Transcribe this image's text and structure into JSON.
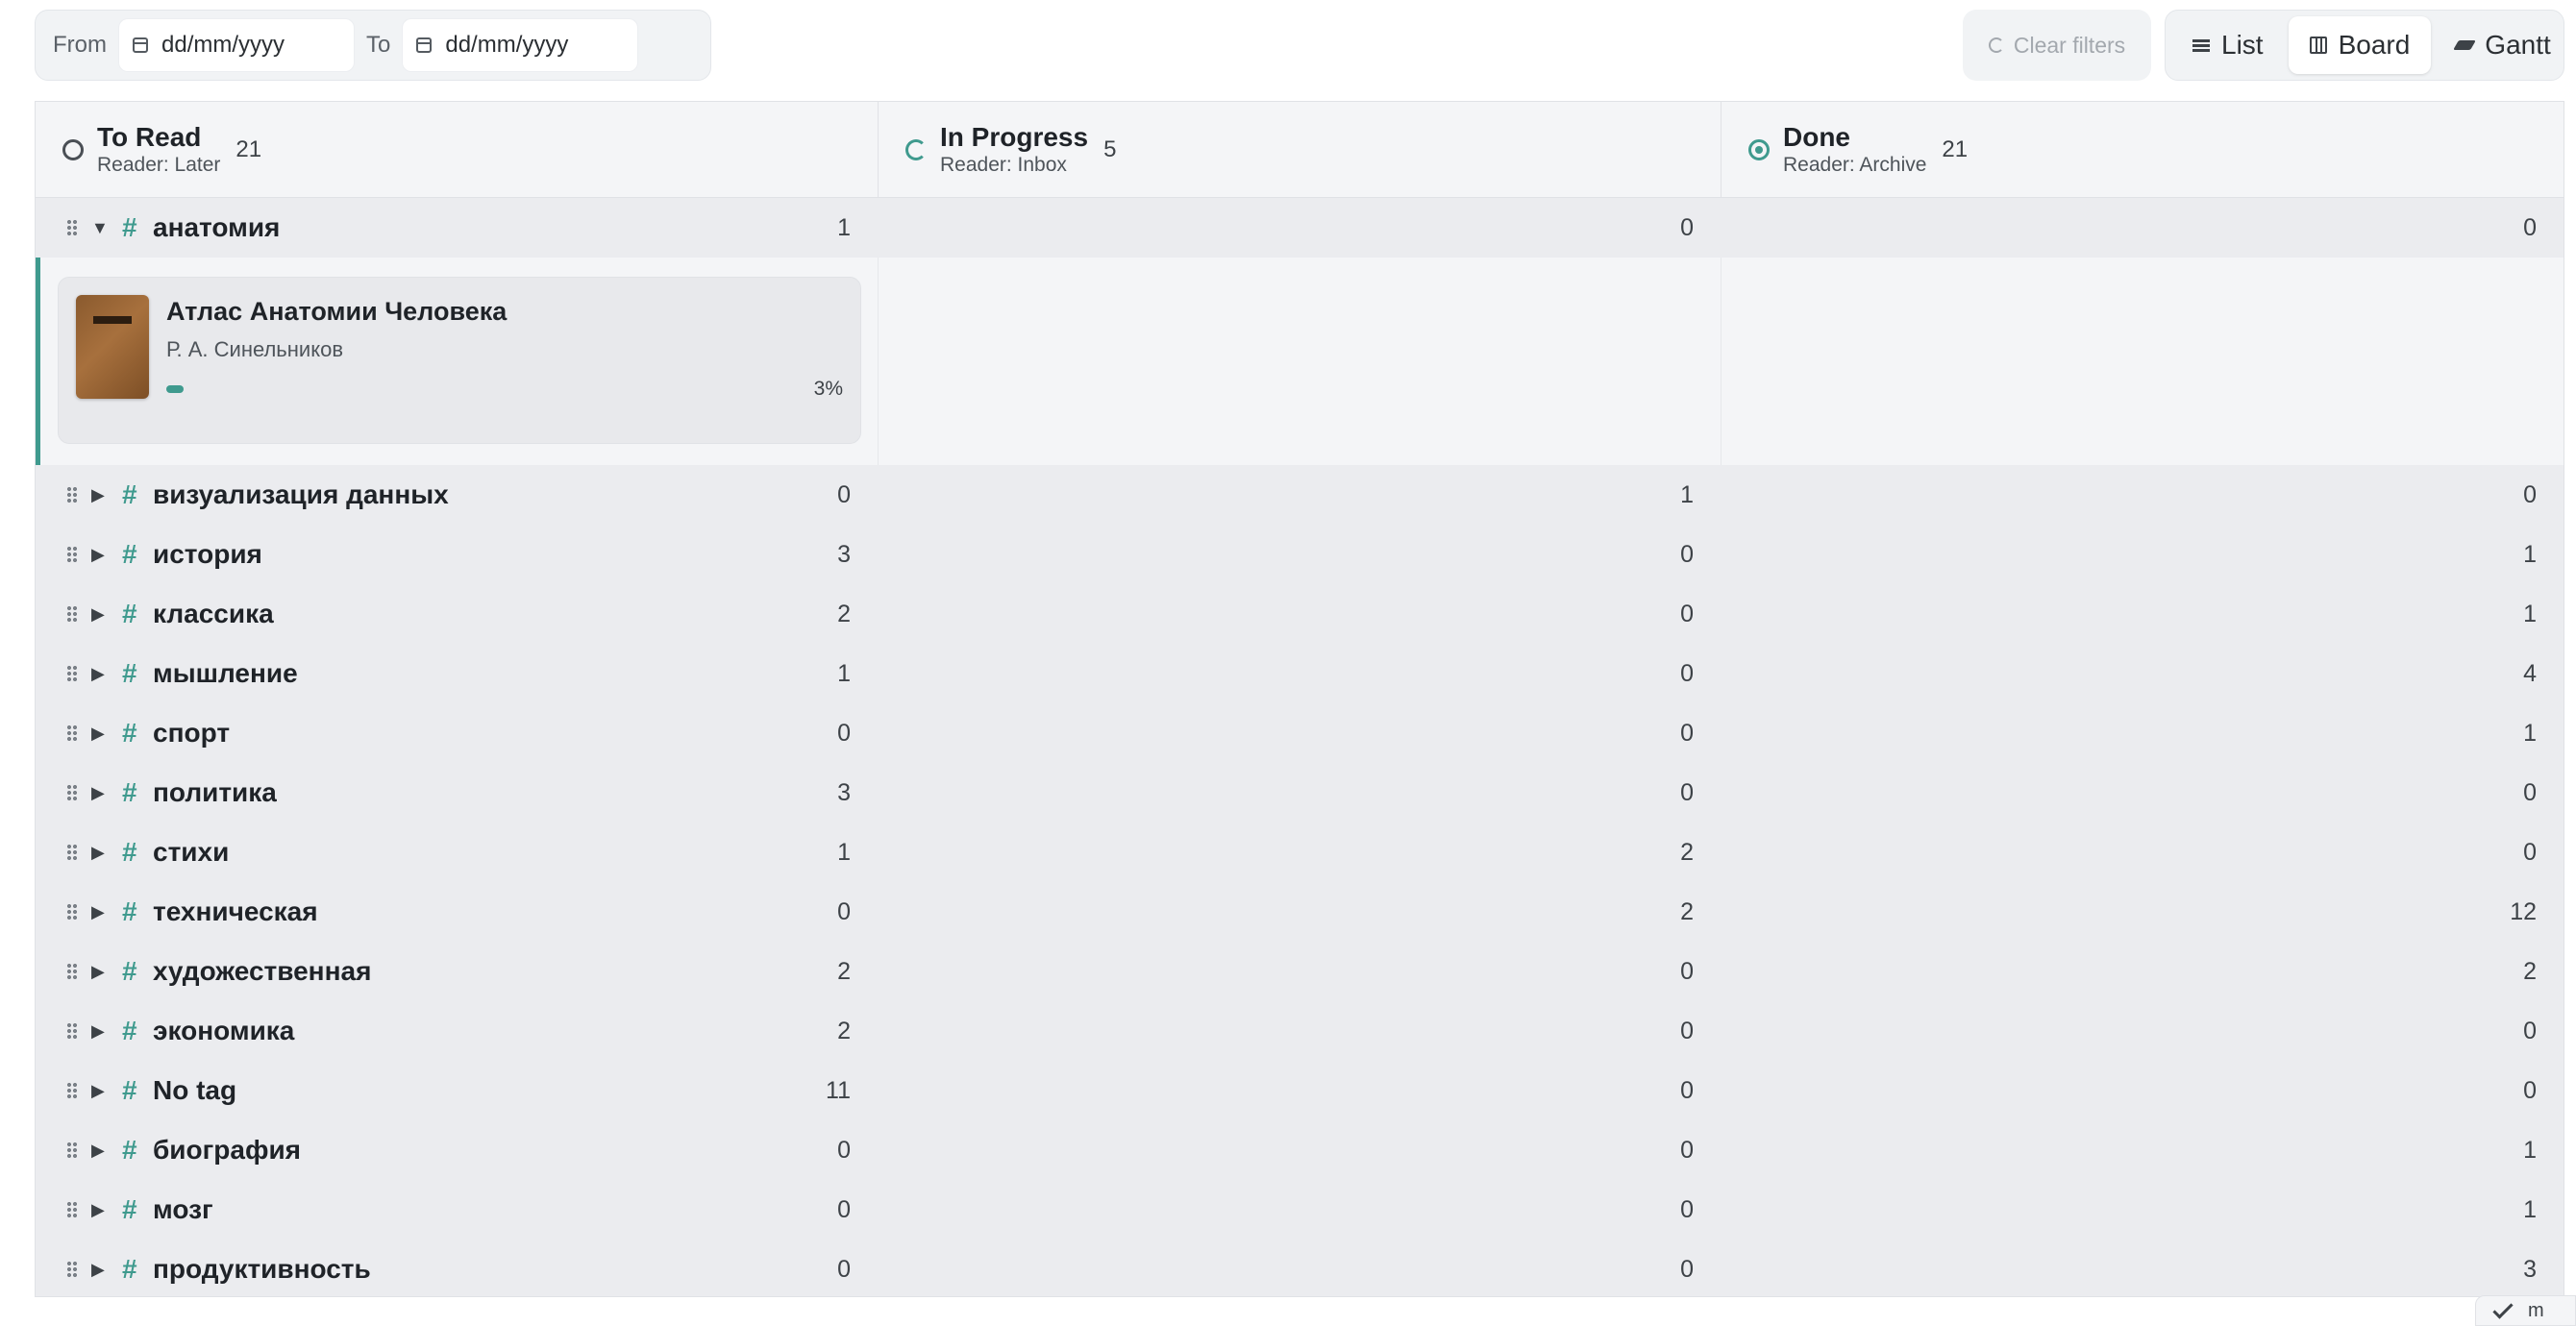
{
  "filters": {
    "from_label": "From",
    "from_value": "dd/mm/yyyy",
    "to_label": "To",
    "to_value": "dd/mm/yyyy",
    "clear_label": "Clear filters"
  },
  "views": [
    {
      "label": "List",
      "icon": "list-icon",
      "active": false
    },
    {
      "label": "Board",
      "icon": "board-icon",
      "active": true
    },
    {
      "label": "Gantt",
      "icon": "gantt-icon",
      "active": false
    }
  ],
  "columns": [
    {
      "title": "To Read",
      "subtitle": "Reader: Later",
      "count": "21",
      "icon": "circle-outline-icon"
    },
    {
      "title": "In Progress",
      "subtitle": "Reader: Inbox",
      "count": "5",
      "icon": "progress-circle-icon"
    },
    {
      "title": "Done",
      "subtitle": "Reader: Archive",
      "count": "21",
      "icon": "done-circle-icon"
    }
  ],
  "expanded_group": {
    "hash": "#",
    "tag": "анатомия",
    "counts": [
      "1",
      "0",
      "0"
    ],
    "book": {
      "title": "Атлас Анатомии Человека",
      "author": "Р. А. Синельников",
      "progress_label": "3%",
      "progress": 0.03
    }
  },
  "groups": [
    {
      "tag": "визуализация данных",
      "counts": [
        "0",
        "1",
        "0"
      ]
    },
    {
      "tag": "история",
      "counts": [
        "3",
        "0",
        "1"
      ]
    },
    {
      "tag": "классика",
      "counts": [
        "2",
        "0",
        "1"
      ]
    },
    {
      "tag": "мышление",
      "counts": [
        "1",
        "0",
        "4"
      ]
    },
    {
      "tag": "спорт",
      "counts": [
        "0",
        "0",
        "1"
      ]
    },
    {
      "tag": "политика",
      "counts": [
        "3",
        "0",
        "0"
      ]
    },
    {
      "tag": "стихи",
      "counts": [
        "1",
        "2",
        "0"
      ]
    },
    {
      "tag": "техническая",
      "counts": [
        "0",
        "2",
        "12"
      ]
    },
    {
      "tag": "художественная",
      "counts": [
        "2",
        "0",
        "2"
      ]
    },
    {
      "tag": "экономика",
      "counts": [
        "2",
        "0",
        "0"
      ]
    },
    {
      "tag": "No tag",
      "counts": [
        "11",
        "0",
        "0"
      ]
    },
    {
      "tag": "биография",
      "counts": [
        "0",
        "0",
        "1"
      ]
    },
    {
      "tag": "мозг",
      "counts": [
        "0",
        "0",
        "1"
      ]
    },
    {
      "tag": "продуктивность",
      "counts": [
        "0",
        "0",
        "3"
      ]
    }
  ],
  "corner": {
    "text": "m"
  },
  "colors": {
    "accent": "#3f9a8e",
    "board_bg": "#ebecef",
    "header_bg": "#f4f5f7"
  }
}
